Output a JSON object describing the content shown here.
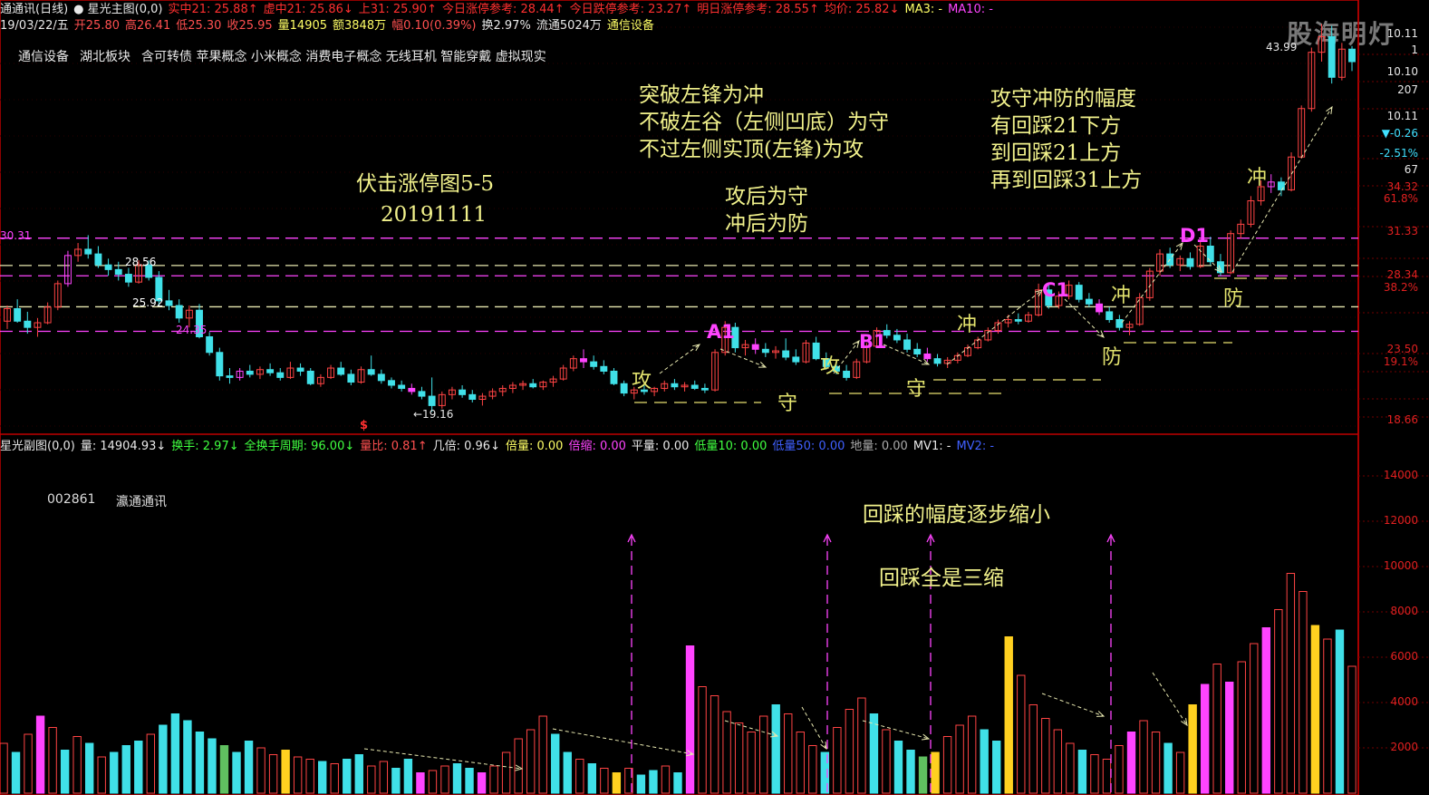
{
  "header_line1": [
    {
      "text": "通通讯(日线)",
      "color": "#e8e8e8"
    },
    {
      "text": "● 星光主图(0,0)",
      "color": "#e8e8e8"
    },
    {
      "text": "实中21: 25.88↑",
      "color": "#ff3030"
    },
    {
      "text": "虚中21: 25.86↓",
      "color": "#ff3030"
    },
    {
      "text": "上31: 25.90↑",
      "color": "#ff3030"
    },
    {
      "text": "今日涨停参考: 28.44↑",
      "color": "#ff3030"
    },
    {
      "text": "今日跌停参考: 23.27↑",
      "color": "#ff3030"
    },
    {
      "text": "明日涨停参考: 28.55↑",
      "color": "#ff3030"
    },
    {
      "text": "均价: 25.82↓",
      "color": "#ff3030"
    },
    {
      "text": "MA3: -",
      "color": "#ffff66"
    },
    {
      "text": "MA10: -",
      "color": "#ff44ff"
    }
  ],
  "header_line2": [
    {
      "text": "19/03/22/五",
      "color": "#e8e8e8"
    },
    {
      "text": "开25.80",
      "color": "#ff5050"
    },
    {
      "text": "高26.41",
      "color": "#ff5050"
    },
    {
      "text": "低25.30",
      "color": "#ff5050"
    },
    {
      "text": "收25.95",
      "color": "#ff5050"
    },
    {
      "text": "量14905",
      "color": "#ffff66"
    },
    {
      "text": "额3848万",
      "color": "#ffff66"
    },
    {
      "text": "幅0.10(0.39%)",
      "color": "#ff5050"
    },
    {
      "text": "换2.97%",
      "color": "#e8e8e8"
    },
    {
      "text": "流通5024万",
      "color": "#e8e8e8"
    },
    {
      "text": "通信设备",
      "color": "#ffff66"
    }
  ],
  "concept_tags": [
    "通信设备",
    "湖北板块",
    "含可转债 苹果概念 小米概念 消费电子概念 无线耳机 智能穿戴 虚拟现实"
  ],
  "watermark": "股海明灯",
  "notes": {
    "title1": "伏击涨停图5-5",
    "title2": "20191111",
    "rule1": "突破左锋为冲",
    "rule2": "不破左谷（左侧凹底）为守",
    "rule3": "不过左侧实顶(左锋)为攻",
    "rule4": "攻后为守",
    "rule5": "冲后为防",
    "range1": "攻守冲防的幅度",
    "range2": "有回踩21下方",
    "range3": "到回踩21上方",
    "range4": "再到回踩31上方",
    "vol1": "回踩的幅度逐步缩小",
    "vol2": "回踩全是三缩"
  },
  "labels": {
    "gong": "攻",
    "shou": "守",
    "chong": "冲",
    "fang": "防",
    "a1": "A1",
    "b1": "B1",
    "c1": "C1",
    "d1": "D1"
  },
  "price_marks": {
    "p3031": "30.31",
    "p2856": "28.56",
    "p2592": "25.92",
    "p2435": "24.35",
    "p1916": "←19.16",
    "p4399": "43.99",
    "dollar": "$"
  },
  "right_axis": [
    {
      "text": "10.11",
      "color": "#e8e8e8"
    },
    {
      "text": "1",
      "color": "#e8e8e8"
    },
    {
      "text": "10.10",
      "color": "#e8e8e8"
    },
    {
      "text": "207",
      "color": "#e8e8e8"
    },
    {
      "text": "10.11",
      "color": "#e8e8e8"
    },
    {
      "text": "▼-0.26",
      "color": "#40e0ff"
    },
    {
      "text": "-2.51%",
      "color": "#40e0ff"
    },
    {
      "text": "67",
      "color": "#e8e8e8"
    },
    {
      "text": "34.32",
      "color": "#e02020"
    },
    {
      "text": "61.8%",
      "color": "#e02020"
    },
    {
      "text": "31.33",
      "color": "#e02020"
    },
    {
      "text": "28.34",
      "color": "#e02020"
    },
    {
      "text": "38.2%",
      "color": "#e02020"
    },
    {
      "text": "23.50",
      "color": "#e02020"
    },
    {
      "text": "19.1%",
      "color": "#e02020"
    },
    {
      "text": "18.66",
      "color": "#e02020"
    }
  ],
  "sub_header": [
    {
      "text": "星光副图(0,0)",
      "color": "#e8e8e8"
    },
    {
      "text": "量: 14904.93↓",
      "color": "#e8e8e8"
    },
    {
      "text": "换手: 2.97↓",
      "color": "#40ff40"
    },
    {
      "text": "全换手周期: 96.00↓",
      "color": "#40ff40"
    },
    {
      "text": "量比: 0.81↑",
      "color": "#ff5050"
    },
    {
      "text": "几倍: 0.96↓",
      "color": "#e8e8e8"
    },
    {
      "text": "倍量: 0.00",
      "color": "#ffff66"
    },
    {
      "text": "倍缩: 0.00",
      "color": "#ff44ff"
    },
    {
      "text": "平量: 0.00",
      "color": "#e8e8e8"
    },
    {
      "text": "低量10: 0.00",
      "color": "#40ff40"
    },
    {
      "text": "低量50: 0.00",
      "color": "#4060ff"
    },
    {
      "text": "地量: 0.00",
      "color": "#aaaaaa"
    },
    {
      "text": "MV1: -",
      "color": "#e8e8e8"
    },
    {
      "text": "MV2: -",
      "color": "#4060ff"
    }
  ],
  "stock_code": "002861",
  "stock_name": "瀛通通讯",
  "volume_axis": [
    "14000",
    "12000",
    "10000",
    "8000",
    "6000",
    "4000",
    "2000"
  ],
  "colors": {
    "up": "#ff4444",
    "down": "#40e0e8",
    "magenta": "#ff44ff",
    "yellow": "#ffd020",
    "guide": "#e8e070",
    "frame": "#c00000"
  },
  "chart_data": {
    "type": "candlestick",
    "price_axis_ticks": [
      18.66,
      23.5,
      28.34,
      31.33,
      34.32
    ],
    "price_range": [
      18.0,
      44.5
    ],
    "reference_lines": [
      {
        "value": 30.31,
        "style": "magenta-dashed"
      },
      {
        "value": 28.56,
        "style": "white-dashed"
      },
      {
        "value": 27.9,
        "style": "magenta-dashed"
      },
      {
        "value": 25.92,
        "style": "white-dashed"
      },
      {
        "value": 24.35,
        "style": "magenta-dashed"
      }
    ],
    "candles": [
      [
        25.0,
        26.0,
        24.5,
        25.8
      ],
      [
        25.8,
        26.4,
        24.9,
        25.0
      ],
      [
        25.0,
        25.6,
        24.2,
        24.6
      ],
      [
        24.6,
        25.2,
        24.0,
        24.9
      ],
      [
        24.9,
        26.2,
        24.8,
        25.9
      ],
      [
        25.9,
        27.6,
        25.7,
        27.4
      ],
      [
        27.4,
        29.5,
        27.2,
        29.2
      ],
      [
        29.2,
        30.0,
        28.8,
        29.6
      ],
      [
        29.6,
        30.5,
        29.0,
        29.3
      ],
      [
        29.3,
        29.8,
        28.4,
        28.6
      ],
      [
        28.6,
        29.0,
        27.9,
        28.3
      ],
      [
        28.3,
        28.8,
        27.6,
        28.0
      ],
      [
        28.0,
        28.4,
        27.2,
        27.5
      ],
      [
        27.5,
        28.9,
        27.4,
        28.6
      ],
      [
        28.6,
        28.9,
        27.6,
        27.8
      ],
      [
        27.8,
        28.2,
        26.0,
        26.3
      ],
      [
        26.3,
        27.0,
        25.7,
        26.0
      ],
      [
        26.0,
        26.4,
        24.9,
        25.2
      ],
      [
        25.2,
        26.0,
        24.6,
        25.7
      ],
      [
        25.7,
        26.1,
        23.9,
        24.0
      ],
      [
        24.0,
        24.3,
        22.8,
        23.0
      ],
      [
        23.0,
        23.3,
        21.2,
        21.5
      ],
      [
        21.5,
        22.0,
        21.0,
        21.4
      ],
      [
        21.4,
        22.0,
        21.2,
        21.8
      ],
      [
        21.8,
        22.2,
        21.4,
        21.6
      ],
      [
        21.6,
        22.1,
        21.3,
        21.9
      ],
      [
        21.9,
        22.3,
        21.5,
        21.7
      ],
      [
        21.7,
        22.0,
        21.2,
        21.4
      ],
      [
        21.4,
        22.4,
        21.3,
        22.0
      ],
      [
        22.0,
        22.3,
        21.5,
        21.8
      ],
      [
        21.8,
        22.0,
        20.9,
        21.0
      ],
      [
        21.0,
        21.6,
        20.8,
        21.4
      ],
      [
        21.4,
        22.2,
        21.3,
        22.0
      ],
      [
        22.0,
        22.4,
        21.5,
        21.6
      ],
      [
        21.6,
        21.9,
        20.9,
        21.1
      ],
      [
        21.1,
        22.1,
        21.0,
        21.9
      ],
      [
        21.9,
        22.8,
        21.5,
        21.6
      ],
      [
        21.6,
        21.9,
        21.0,
        21.2
      ],
      [
        21.2,
        21.4,
        20.7,
        20.9
      ],
      [
        20.9,
        21.2,
        20.5,
        20.7
      ],
      [
        20.7,
        21.0,
        20.3,
        20.5
      ],
      [
        20.5,
        20.8,
        20.0,
        20.2
      ],
      [
        20.2,
        21.4,
        19.2,
        19.6
      ],
      [
        19.6,
        20.5,
        19.4,
        20.3
      ],
      [
        20.3,
        20.8,
        20.0,
        20.6
      ],
      [
        20.6,
        20.9,
        20.1,
        20.3
      ],
      [
        20.3,
        20.6,
        19.8,
        20.0
      ],
      [
        20.0,
        20.4,
        19.6,
        20.2
      ],
      [
        20.2,
        20.7,
        20.0,
        20.5
      ],
      [
        20.5,
        20.9,
        20.2,
        20.7
      ],
      [
        20.7,
        21.1,
        20.4,
        20.9
      ],
      [
        20.9,
        21.2,
        20.6,
        21.0
      ],
      [
        21.0,
        21.3,
        20.7,
        20.8
      ],
      [
        20.8,
        21.2,
        20.6,
        21.1
      ],
      [
        21.1,
        21.5,
        20.8,
        21.3
      ],
      [
        21.3,
        22.2,
        21.2,
        22.0
      ],
      [
        22.0,
        22.8,
        21.8,
        22.6
      ],
      [
        22.6,
        23.2,
        22.0,
        22.4
      ],
      [
        22.4,
        22.8,
        21.9,
        22.1
      ],
      [
        22.1,
        22.5,
        21.6,
        21.8
      ],
      [
        21.8,
        22.0,
        20.9,
        21.0
      ],
      [
        21.0,
        21.2,
        20.2,
        20.4
      ],
      [
        20.4,
        20.8,
        20.0,
        20.6
      ],
      [
        20.6,
        20.9,
        20.3,
        20.5
      ],
      [
        20.5,
        20.8,
        20.2,
        20.7
      ],
      [
        20.7,
        21.2,
        20.5,
        21.0
      ],
      [
        21.0,
        21.3,
        20.6,
        20.8
      ],
      [
        20.8,
        21.1,
        20.5,
        20.9
      ],
      [
        20.9,
        21.2,
        20.6,
        20.7
      ],
      [
        20.7,
        21.0,
        20.4,
        20.6
      ],
      [
        20.6,
        23.2,
        20.5,
        23.0
      ],
      [
        23.0,
        25.0,
        22.8,
        24.6
      ],
      [
        24.6,
        24.9,
        23.0,
        23.3
      ],
      [
        23.3,
        23.8,
        22.8,
        23.5
      ],
      [
        23.5,
        23.9,
        22.9,
        23.2
      ],
      [
        23.2,
        23.6,
        22.7,
        23.0
      ],
      [
        23.0,
        23.4,
        22.6,
        23.1
      ],
      [
        23.1,
        23.9,
        22.5,
        22.7
      ],
      [
        22.7,
        23.2,
        22.2,
        22.4
      ],
      [
        22.4,
        23.8,
        22.3,
        23.6
      ],
      [
        23.6,
        24.0,
        22.5,
        22.6
      ],
      [
        22.6,
        23.0,
        21.9,
        22.1
      ],
      [
        22.1,
        22.5,
        21.6,
        21.8
      ],
      [
        21.8,
        22.2,
        21.2,
        21.4
      ],
      [
        21.4,
        22.6,
        21.3,
        22.4
      ],
      [
        22.4,
        23.6,
        22.3,
        23.4
      ],
      [
        23.4,
        24.6,
        23.3,
        24.4
      ],
      [
        24.4,
        24.8,
        23.9,
        24.1
      ],
      [
        24.1,
        24.5,
        23.6,
        23.8
      ],
      [
        23.8,
        24.2,
        23.0,
        23.2
      ],
      [
        23.2,
        23.6,
        22.7,
        22.9
      ],
      [
        22.9,
        23.3,
        22.4,
        22.6
      ],
      [
        22.6,
        22.9,
        22.1,
        22.3
      ],
      [
        22.3,
        22.7,
        22.0,
        22.5
      ],
      [
        22.5,
        23.0,
        22.3,
        22.8
      ],
      [
        22.8,
        23.5,
        22.7,
        23.3
      ],
      [
        23.3,
        24.0,
        23.2,
        23.8
      ],
      [
        23.8,
        24.6,
        23.7,
        24.4
      ],
      [
        24.4,
        25.1,
        24.2,
        24.9
      ],
      [
        24.9,
        25.4,
        24.6,
        25.1
      ],
      [
        25.1,
        25.5,
        24.8,
        25.0
      ],
      [
        25.0,
        25.6,
        24.9,
        25.4
      ],
      [
        25.4,
        27.4,
        25.3,
        27.0
      ],
      [
        27.0,
        27.3,
        25.8,
        26.0
      ],
      [
        26.0,
        26.9,
        25.8,
        26.6
      ],
      [
        26.6,
        27.6,
        26.4,
        27.3
      ],
      [
        27.3,
        27.5,
        26.2,
        26.4
      ],
      [
        26.4,
        26.8,
        25.9,
        26.1
      ],
      [
        26.1,
        26.4,
        25.4,
        25.6
      ],
      [
        25.6,
        25.9,
        24.9,
        25.1
      ],
      [
        25.1,
        25.4,
        24.4,
        24.6
      ],
      [
        24.6,
        25.0,
        24.1,
        24.8
      ],
      [
        24.8,
        26.8,
        24.7,
        26.5
      ],
      [
        26.5,
        28.4,
        26.3,
        28.2
      ],
      [
        28.2,
        29.6,
        27.9,
        29.3
      ],
      [
        29.3,
        29.7,
        28.4,
        28.6
      ],
      [
        28.6,
        29.2,
        28.2,
        29.0
      ],
      [
        29.0,
        29.4,
        28.3,
        28.5
      ],
      [
        28.5,
        30.2,
        28.4,
        29.8
      ],
      [
        29.8,
        30.4,
        28.6,
        28.8
      ],
      [
        28.8,
        29.3,
        27.9,
        28.1
      ],
      [
        28.1,
        30.8,
        28.0,
        30.6
      ],
      [
        30.6,
        31.5,
        30.3,
        31.2
      ],
      [
        31.2,
        33.0,
        31.0,
        32.7
      ],
      [
        32.7,
        34.0,
        32.4,
        33.6
      ],
      [
        33.6,
        34.4,
        33.2,
        33.9
      ],
      [
        33.9,
        34.2,
        33.0,
        33.4
      ],
      [
        33.4,
        35.8,
        33.3,
        35.5
      ],
      [
        35.5,
        38.8,
        35.4,
        38.6
      ],
      [
        38.6,
        42.5,
        38.4,
        42.2
      ],
      [
        42.2,
        44.0,
        41.6,
        43.2
      ],
      [
        43.2,
        43.9,
        40.2,
        40.6
      ],
      [
        40.6,
        42.8,
        40.4,
        42.4
      ],
      [
        42.4,
        42.6,
        41.0,
        41.6
      ]
    ],
    "volume_axis_range": [
      0,
      14800
    ],
    "volume": [
      [
        2200,
        "up"
      ],
      [
        1800,
        "down"
      ],
      [
        2600,
        "up"
      ],
      [
        3400,
        "magenta"
      ],
      [
        2900,
        "up"
      ],
      [
        1900,
        "down"
      ],
      [
        2500,
        "up"
      ],
      [
        2200,
        "down"
      ],
      [
        1600,
        "up"
      ],
      [
        1800,
        "down"
      ],
      [
        2100,
        "down"
      ],
      [
        2300,
        "down"
      ],
      [
        2600,
        "up"
      ],
      [
        3000,
        "down"
      ],
      [
        3500,
        "down"
      ],
      [
        3200,
        "down"
      ],
      [
        2700,
        "down"
      ],
      [
        2400,
        "down"
      ],
      [
        2100,
        "green"
      ],
      [
        1800,
        "down"
      ],
      [
        2300,
        "down"
      ],
      [
        2000,
        "up"
      ],
      [
        1700,
        "up"
      ],
      [
        1900,
        "yellow"
      ],
      [
        1600,
        "up"
      ],
      [
        1500,
        "up"
      ],
      [
        1400,
        "down"
      ],
      [
        1300,
        "up"
      ],
      [
        1500,
        "down"
      ],
      [
        1700,
        "down"
      ],
      [
        1200,
        "up"
      ],
      [
        1400,
        "up"
      ],
      [
        1100,
        "down"
      ],
      [
        1500,
        "down"
      ],
      [
        900,
        "magenta"
      ],
      [
        1000,
        "up"
      ],
      [
        1200,
        "up"
      ],
      [
        1300,
        "down"
      ],
      [
        1100,
        "down"
      ],
      [
        900,
        "magenta"
      ],
      [
        1200,
        "up"
      ],
      [
        1800,
        "up"
      ],
      [
        2400,
        "up"
      ],
      [
        2800,
        "up"
      ],
      [
        3400,
        "up"
      ],
      [
        2600,
        "down"
      ],
      [
        1800,
        "down"
      ],
      [
        1500,
        "up"
      ],
      [
        1300,
        "down"
      ],
      [
        1100,
        "up"
      ],
      [
        900,
        "yellow"
      ],
      [
        1100,
        "up"
      ],
      [
        800,
        "down"
      ],
      [
        1000,
        "down"
      ],
      [
        1200,
        "up"
      ],
      [
        900,
        "down"
      ],
      [
        6500,
        "magenta"
      ],
      [
        4700,
        "up"
      ],
      [
        4300,
        "up"
      ],
      [
        3600,
        "up"
      ],
      [
        3100,
        "up"
      ],
      [
        2700,
        "up"
      ],
      [
        3400,
        "up"
      ],
      [
        3900,
        "down"
      ],
      [
        3500,
        "up"
      ],
      [
        2700,
        "up"
      ],
      [
        2100,
        "up"
      ],
      [
        1800,
        "down"
      ],
      [
        2900,
        "up"
      ],
      [
        3700,
        "up"
      ],
      [
        4200,
        "up"
      ],
      [
        3500,
        "down"
      ],
      [
        2800,
        "up"
      ],
      [
        2300,
        "down"
      ],
      [
        1900,
        "down"
      ],
      [
        1600,
        "green"
      ],
      [
        1800,
        "yellow"
      ],
      [
        2500,
        "up"
      ],
      [
        3000,
        "up"
      ],
      [
        3400,
        "up"
      ],
      [
        2800,
        "down"
      ],
      [
        2300,
        "down"
      ],
      [
        6900,
        "yellow"
      ],
      [
        5200,
        "up"
      ],
      [
        3900,
        "up"
      ],
      [
        3300,
        "up"
      ],
      [
        2800,
        "up"
      ],
      [
        2200,
        "up"
      ],
      [
        1900,
        "down"
      ],
      [
        1700,
        "up"
      ],
      [
        1500,
        "up"
      ],
      [
        2100,
        "up"
      ],
      [
        2700,
        "magenta"
      ],
      [
        3200,
        "up"
      ],
      [
        2700,
        "up"
      ],
      [
        2200,
        "down"
      ],
      [
        1800,
        "up"
      ],
      [
        3900,
        "yellow"
      ],
      [
        4800,
        "magenta"
      ],
      [
        5700,
        "up"
      ],
      [
        4900,
        "magenta"
      ],
      [
        5800,
        "up"
      ],
      [
        6600,
        "up"
      ],
      [
        7300,
        "magenta"
      ],
      [
        8100,
        "up"
      ],
      [
        9700,
        "up"
      ],
      [
        8900,
        "up"
      ],
      [
        7400,
        "yellow"
      ],
      [
        6800,
        "up"
      ],
      [
        7200,
        "down"
      ],
      [
        5600,
        "up"
      ]
    ]
  }
}
